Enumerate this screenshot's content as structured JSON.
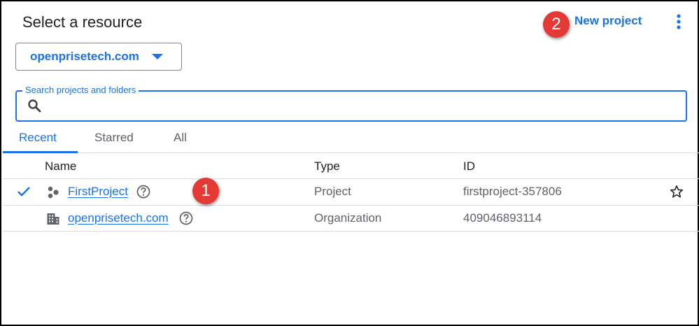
{
  "dialog": {
    "title": "Select a resource",
    "new_project_label": "New project",
    "more_icon": "more-vert-icon"
  },
  "annotations": {
    "badge_1": "1",
    "badge_2": "2"
  },
  "org_selector": {
    "value": "openprisetech.com",
    "icon": "caret-down-icon"
  },
  "search": {
    "label": "Search projects and folders",
    "value": "",
    "icon": "search-icon"
  },
  "tabs": [
    {
      "label": "Recent",
      "active": true
    },
    {
      "label": "Starred",
      "active": false
    },
    {
      "label": "All",
      "active": false
    }
  ],
  "table": {
    "columns": [
      "Name",
      "Type",
      "ID"
    ],
    "rows": [
      {
        "selected": true,
        "icon": "project-icon",
        "name": "FirstProject",
        "type": "Project",
        "id": "firstproject-357806",
        "starrable": true
      },
      {
        "selected": false,
        "icon": "organization-icon",
        "name": "openprisetech.com",
        "type": "Organization",
        "id": "409046893114",
        "starrable": false
      }
    ]
  },
  "colors": {
    "accent": "#1a73e8",
    "badge": "#e53935",
    "divider": "#dadce0"
  }
}
